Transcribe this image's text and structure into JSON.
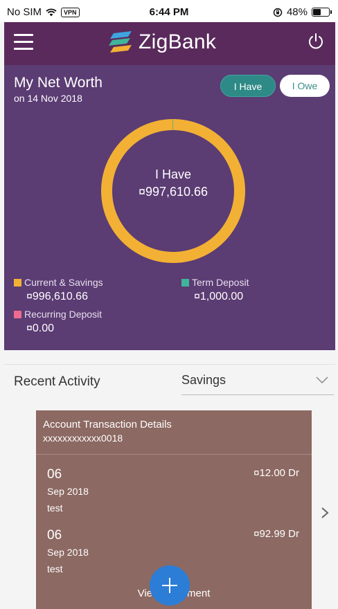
{
  "status_bar": {
    "carrier": "No SIM",
    "vpn": "VPN",
    "time": "6:44 PM",
    "battery": "48%",
    "battery_level": 0.48
  },
  "header": {
    "brand": "ZigBank",
    "icons": [
      "menu-icon",
      "zigbank-logo",
      "power-icon"
    ]
  },
  "net_worth": {
    "title": "My Net Worth",
    "date": "on 14 Nov 2018",
    "toggle_have": "I Have",
    "toggle_owe": "I Owe",
    "center_label": "I Have",
    "center_value": "¤997,610.66",
    "legend": [
      {
        "name": "Current & Savings",
        "amount": "¤996,610.66",
        "color": "#f2b134"
      },
      {
        "name": "Term Deposit",
        "amount": "¤1,000.00",
        "color": "#3fb59a"
      },
      {
        "name": "Recurring Deposit",
        "amount": "¤0.00",
        "color": "#ee6b8f"
      }
    ]
  },
  "chart_data": {
    "type": "pie",
    "categories": [
      "Current & Savings",
      "Term Deposit",
      "Recurring Deposit"
    ],
    "values": [
      996610.66,
      1000.0,
      0.0
    ],
    "colors": [
      "#f2b134",
      "#3fb59a",
      "#ee6b8f"
    ],
    "style": "donut"
  },
  "recent_activity": {
    "title": "Recent Activity",
    "account_type": "Savings",
    "card_title": "Account Transaction Details",
    "account_number": "xxxxxxxxxxxx0018",
    "transactions": [
      {
        "day": "06",
        "month": "Sep 2018",
        "desc": "test",
        "amount": "¤12.00 Dr"
      },
      {
        "day": "06",
        "month": "Sep 2018",
        "desc": "test",
        "amount": "¤92.99 Dr"
      }
    ],
    "view_statement": "View Statement"
  },
  "colors": {
    "header": "#5a2a5c",
    "panel": "#5b3c73",
    "accent": "#2e8a86",
    "card": "#8c6962",
    "fab": "#2c7dd6"
  }
}
